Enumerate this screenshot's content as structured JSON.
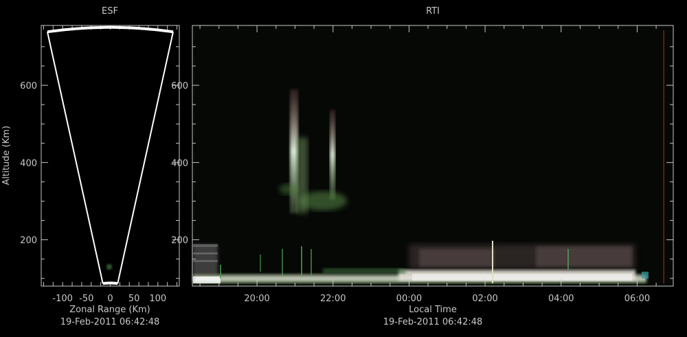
{
  "chart_data": [
    {
      "type": "heatmap",
      "title": "ESF",
      "xlabel": "Zonal Range (Km)",
      "ylabel": "Altitude (Km)",
      "timestamp": "19-Feb-2011 06:42:48",
      "xlim": [
        -145,
        145
      ],
      "ylim": [
        80,
        755
      ],
      "xticks": [
        "-100",
        "-50",
        "0",
        "50",
        "100"
      ],
      "xtick_values": [
        -100,
        -50,
        0,
        50,
        100
      ],
      "yticks": [
        "200",
        "400",
        "600"
      ],
      "ytick_values": [
        200,
        400,
        600
      ],
      "fan_outline": {
        "inner_radius_km": 88,
        "outer_radius_km": 750,
        "left_edge_zonal_km": -132,
        "right_edge_zonal_km": 132
      }
    },
    {
      "type": "heatmap",
      "title": "RTI",
      "xlabel": "Local Time",
      "ylabel": "",
      "timestamp": "19-Feb-2011 06:42:48",
      "xlim_hours": [
        18.3,
        30.95
      ],
      "ylim": [
        80,
        755
      ],
      "xticks": [
        "20:00",
        "22:00",
        "00:00",
        "02:00",
        "04:00",
        "06:00"
      ],
      "xtick_hours": [
        20,
        22,
        24,
        26,
        28,
        30
      ],
      "yticks": [
        "200",
        "400",
        "600"
      ],
      "ytick_values": [
        200,
        400,
        600
      ],
      "current_time_marker_hours": 30.7,
      "marker_color": "#b03020"
    }
  ]
}
